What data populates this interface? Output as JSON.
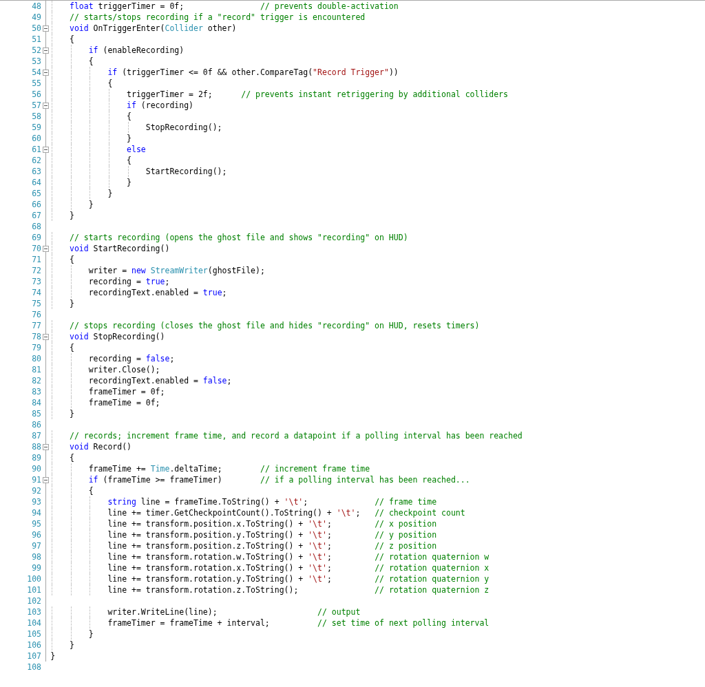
{
  "editor": {
    "lines": [
      {
        "number": "48",
        "foldable": false,
        "tokens": [
          {
            "kind": "keyword",
            "text": "    float"
          },
          {
            "kind": "plain",
            "text": " triggerTimer = 0f;                "
          },
          {
            "kind": "comment",
            "text": "// prevents double-activation"
          }
        ]
      },
      {
        "number": "49",
        "foldable": false,
        "tokens": [
          {
            "kind": "comment",
            "text": "    // starts/stops recording if a \"record\" trigger is encountered"
          }
        ]
      },
      {
        "number": "50",
        "foldable": true,
        "tokens": [
          {
            "kind": "keyword",
            "text": "    void"
          },
          {
            "kind": "plain",
            "text": " OnTriggerEnter("
          },
          {
            "kind": "type",
            "text": "Collider"
          },
          {
            "kind": "plain",
            "text": " other)"
          }
        ]
      },
      {
        "number": "51",
        "foldable": false,
        "tokens": [
          {
            "kind": "plain",
            "text": "    {"
          }
        ]
      },
      {
        "number": "52",
        "foldable": true,
        "tokens": [
          {
            "kind": "keyword",
            "text": "        if"
          },
          {
            "kind": "plain",
            "text": " (enableRecording)"
          }
        ]
      },
      {
        "number": "53",
        "foldable": false,
        "tokens": [
          {
            "kind": "plain",
            "text": "        {"
          }
        ]
      },
      {
        "number": "54",
        "foldable": true,
        "tokens": [
          {
            "kind": "keyword",
            "text": "            if"
          },
          {
            "kind": "plain",
            "text": " (triggerTimer <= 0f && other.CompareTag("
          },
          {
            "kind": "string",
            "text": "\"Record Trigger\""
          },
          {
            "kind": "plain",
            "text": "))"
          }
        ]
      },
      {
        "number": "55",
        "foldable": false,
        "tokens": [
          {
            "kind": "plain",
            "text": "            {"
          }
        ]
      },
      {
        "number": "56",
        "foldable": false,
        "tokens": [
          {
            "kind": "plain",
            "text": "                triggerTimer = 2f;      "
          },
          {
            "kind": "comment",
            "text": "// prevents instant retriggering by additional colliders"
          }
        ]
      },
      {
        "number": "57",
        "foldable": true,
        "tokens": [
          {
            "kind": "keyword",
            "text": "                if"
          },
          {
            "kind": "plain",
            "text": " (recording)"
          }
        ]
      },
      {
        "number": "58",
        "foldable": false,
        "tokens": [
          {
            "kind": "plain",
            "text": "                {"
          }
        ]
      },
      {
        "number": "59",
        "foldable": false,
        "tokens": [
          {
            "kind": "plain",
            "text": "                    StopRecording();"
          }
        ]
      },
      {
        "number": "60",
        "foldable": false,
        "tokens": [
          {
            "kind": "plain",
            "text": "                }"
          }
        ]
      },
      {
        "number": "61",
        "foldable": true,
        "tokens": [
          {
            "kind": "keyword",
            "text": "                else"
          }
        ]
      },
      {
        "number": "62",
        "foldable": false,
        "tokens": [
          {
            "kind": "plain",
            "text": "                {"
          }
        ]
      },
      {
        "number": "63",
        "foldable": false,
        "tokens": [
          {
            "kind": "plain",
            "text": "                    StartRecording();"
          }
        ]
      },
      {
        "number": "64",
        "foldable": false,
        "tokens": [
          {
            "kind": "plain",
            "text": "                }"
          }
        ]
      },
      {
        "number": "65",
        "foldable": false,
        "tokens": [
          {
            "kind": "plain",
            "text": "            }"
          }
        ]
      },
      {
        "number": "66",
        "foldable": false,
        "tokens": [
          {
            "kind": "plain",
            "text": "        }"
          }
        ]
      },
      {
        "number": "67",
        "foldable": false,
        "tokens": [
          {
            "kind": "plain",
            "text": "    }"
          }
        ]
      },
      {
        "number": "68",
        "foldable": false
      },
      {
        "number": "69",
        "foldable": false,
        "tokens": [
          {
            "kind": "comment",
            "text": "    // starts recording (opens the ghost file and shows \"recording\" on HUD)"
          }
        ]
      },
      {
        "number": "70",
        "foldable": true,
        "tokens": [
          {
            "kind": "keyword",
            "text": "    void"
          },
          {
            "kind": "plain",
            "text": " StartRecording()"
          }
        ]
      },
      {
        "number": "71",
        "foldable": false,
        "tokens": [
          {
            "kind": "plain",
            "text": "    {"
          }
        ]
      },
      {
        "number": "72",
        "foldable": false,
        "tokens": [
          {
            "kind": "plain",
            "text": "        writer = "
          },
          {
            "kind": "keyword",
            "text": "new"
          },
          {
            "kind": "type",
            "text": " StreamWriter"
          },
          {
            "kind": "plain",
            "text": "(ghostFile);"
          }
        ]
      },
      {
        "number": "73",
        "foldable": false,
        "tokens": [
          {
            "kind": "plain",
            "text": "        recording = "
          },
          {
            "kind": "keyword",
            "text": "true"
          },
          {
            "kind": "plain",
            "text": ";"
          }
        ]
      },
      {
        "number": "74",
        "foldable": false,
        "tokens": [
          {
            "kind": "plain",
            "text": "        recordingText.enabled = "
          },
          {
            "kind": "keyword",
            "text": "true"
          },
          {
            "kind": "plain",
            "text": ";"
          }
        ]
      },
      {
        "number": "75",
        "foldable": false,
        "tokens": [
          {
            "kind": "plain",
            "text": "    }"
          }
        ]
      },
      {
        "number": "76",
        "foldable": false
      },
      {
        "number": "77",
        "foldable": false,
        "tokens": [
          {
            "kind": "comment",
            "text": "    // stops recording (closes the ghost file and hides \"recording\" on HUD, resets timers)"
          }
        ]
      },
      {
        "number": "78",
        "foldable": true,
        "tokens": [
          {
            "kind": "keyword",
            "text": "    void"
          },
          {
            "kind": "plain",
            "text": " StopRecording()"
          }
        ]
      },
      {
        "number": "79",
        "foldable": false,
        "tokens": [
          {
            "kind": "plain",
            "text": "    {"
          }
        ]
      },
      {
        "number": "80",
        "foldable": false,
        "tokens": [
          {
            "kind": "plain",
            "text": "        recording = "
          },
          {
            "kind": "keyword",
            "text": "false"
          },
          {
            "kind": "plain",
            "text": ";"
          }
        ]
      },
      {
        "number": "81",
        "foldable": false,
        "tokens": [
          {
            "kind": "plain",
            "text": "        writer.Close();"
          }
        ]
      },
      {
        "number": "82",
        "foldable": false,
        "tokens": [
          {
            "kind": "plain",
            "text": "        recordingText.enabled = "
          },
          {
            "kind": "keyword",
            "text": "false"
          },
          {
            "kind": "plain",
            "text": ";"
          }
        ]
      },
      {
        "number": "83",
        "foldable": false,
        "tokens": [
          {
            "kind": "plain",
            "text": "        frameTimer = 0f;"
          }
        ]
      },
      {
        "number": "84",
        "foldable": false,
        "tokens": [
          {
            "kind": "plain",
            "text": "        frameTime = 0f;"
          }
        ]
      },
      {
        "number": "85",
        "foldable": false,
        "tokens": [
          {
            "kind": "plain",
            "text": "    }"
          }
        ]
      },
      {
        "number": "86",
        "foldable": false
      },
      {
        "number": "87",
        "foldable": false,
        "tokens": [
          {
            "kind": "comment",
            "text": "    // records; increment frame time, and record a datapoint if a polling interval has been reached"
          }
        ]
      },
      {
        "number": "88",
        "foldable": true,
        "tokens": [
          {
            "kind": "keyword",
            "text": "    void"
          },
          {
            "kind": "plain",
            "text": " Record()"
          }
        ]
      },
      {
        "number": "89",
        "foldable": false,
        "tokens": [
          {
            "kind": "plain",
            "text": "    {"
          }
        ]
      },
      {
        "number": "90",
        "foldable": false,
        "tokens": [
          {
            "kind": "plain",
            "text": "        frameTime += "
          },
          {
            "kind": "type",
            "text": "Time"
          },
          {
            "kind": "plain",
            "text": ".deltaTime;        "
          },
          {
            "kind": "comment",
            "text": "// increment frame time"
          }
        ]
      },
      {
        "number": "91",
        "foldable": true,
        "tokens": [
          {
            "kind": "keyword",
            "text": "        if"
          },
          {
            "kind": "plain",
            "text": " (frameTime >= frameTimer)        "
          },
          {
            "kind": "comment",
            "text": "// if a polling interval has been reached..."
          }
        ]
      },
      {
        "number": "92",
        "foldable": false,
        "tokens": [
          {
            "kind": "plain",
            "text": "        {"
          }
        ]
      },
      {
        "number": "93",
        "foldable": false,
        "tokens": [
          {
            "kind": "keyword",
            "text": "            string"
          },
          {
            "kind": "plain",
            "text": " line = frameTime.ToString() + "
          },
          {
            "kind": "string",
            "text": "'\\t'"
          },
          {
            "kind": "plain",
            "text": ";              "
          },
          {
            "kind": "comment",
            "text": "// frame time"
          }
        ]
      },
      {
        "number": "94",
        "foldable": false,
        "tokens": [
          {
            "kind": "plain",
            "text": "            line += timer.GetCheckpointCount().ToString() + "
          },
          {
            "kind": "string",
            "text": "'\\t'"
          },
          {
            "kind": "plain",
            "text": ";   "
          },
          {
            "kind": "comment",
            "text": "// checkpoint count"
          }
        ]
      },
      {
        "number": "95",
        "foldable": false,
        "tokens": [
          {
            "kind": "plain",
            "text": "            line += transform.position.x.ToString() + "
          },
          {
            "kind": "string",
            "text": "'\\t'"
          },
          {
            "kind": "plain",
            "text": ";         "
          },
          {
            "kind": "comment",
            "text": "// x position"
          }
        ]
      },
      {
        "number": "96",
        "foldable": false,
        "tokens": [
          {
            "kind": "plain",
            "text": "            line += transform.position.y.ToString() + "
          },
          {
            "kind": "string",
            "text": "'\\t'"
          },
          {
            "kind": "plain",
            "text": ";         "
          },
          {
            "kind": "comment",
            "text": "// y position"
          }
        ]
      },
      {
        "number": "97",
        "foldable": false,
        "tokens": [
          {
            "kind": "plain",
            "text": "            line += transform.position.z.ToString() + "
          },
          {
            "kind": "string",
            "text": "'\\t'"
          },
          {
            "kind": "plain",
            "text": ";         "
          },
          {
            "kind": "comment",
            "text": "// z position"
          }
        ]
      },
      {
        "number": "98",
        "foldable": false,
        "tokens": [
          {
            "kind": "plain",
            "text": "            line += transform.rotation.w.ToString() + "
          },
          {
            "kind": "string",
            "text": "'\\t'"
          },
          {
            "kind": "plain",
            "text": ";         "
          },
          {
            "kind": "comment",
            "text": "// rotation quaternion w"
          }
        ]
      },
      {
        "number": "99",
        "foldable": false,
        "tokens": [
          {
            "kind": "plain",
            "text": "            line += transform.rotation.x.ToString() + "
          },
          {
            "kind": "string",
            "text": "'\\t'"
          },
          {
            "kind": "plain",
            "text": ";         "
          },
          {
            "kind": "comment",
            "text": "// rotation quaternion x"
          }
        ]
      },
      {
        "number": "100",
        "foldable": false,
        "tokens": [
          {
            "kind": "plain",
            "text": "            line += transform.rotation.y.ToString() + "
          },
          {
            "kind": "string",
            "text": "'\\t'"
          },
          {
            "kind": "plain",
            "text": ";         "
          },
          {
            "kind": "comment",
            "text": "// rotation quaternion y"
          }
        ]
      },
      {
        "number": "101",
        "foldable": false,
        "tokens": [
          {
            "kind": "plain",
            "text": "            line += transform.rotation.z.ToString();                "
          },
          {
            "kind": "comment",
            "text": "// rotation quaternion z"
          }
        ]
      },
      {
        "number": "102",
        "foldable": false
      },
      {
        "number": "103",
        "foldable": false,
        "tokens": [
          {
            "kind": "plain",
            "text": "            writer.WriteLine(line);                     "
          },
          {
            "kind": "comment",
            "text": "// output"
          }
        ]
      },
      {
        "number": "104",
        "foldable": false,
        "tokens": [
          {
            "kind": "plain",
            "text": "            frameTimer = frameTime + interval;          "
          },
          {
            "kind": "comment",
            "text": "// set time of next polling interval"
          }
        ]
      },
      {
        "number": "105",
        "foldable": false,
        "tokens": [
          {
            "kind": "plain",
            "text": "        }"
          }
        ]
      },
      {
        "number": "106",
        "foldable": false,
        "tokens": [
          {
            "kind": "plain",
            "text": "    }"
          }
        ]
      },
      {
        "number": "107",
        "foldable": false,
        "tokens": [
          {
            "kind": "plain",
            "text": "}"
          }
        ]
      },
      {
        "number": "108",
        "foldable": false
      }
    ]
  }
}
